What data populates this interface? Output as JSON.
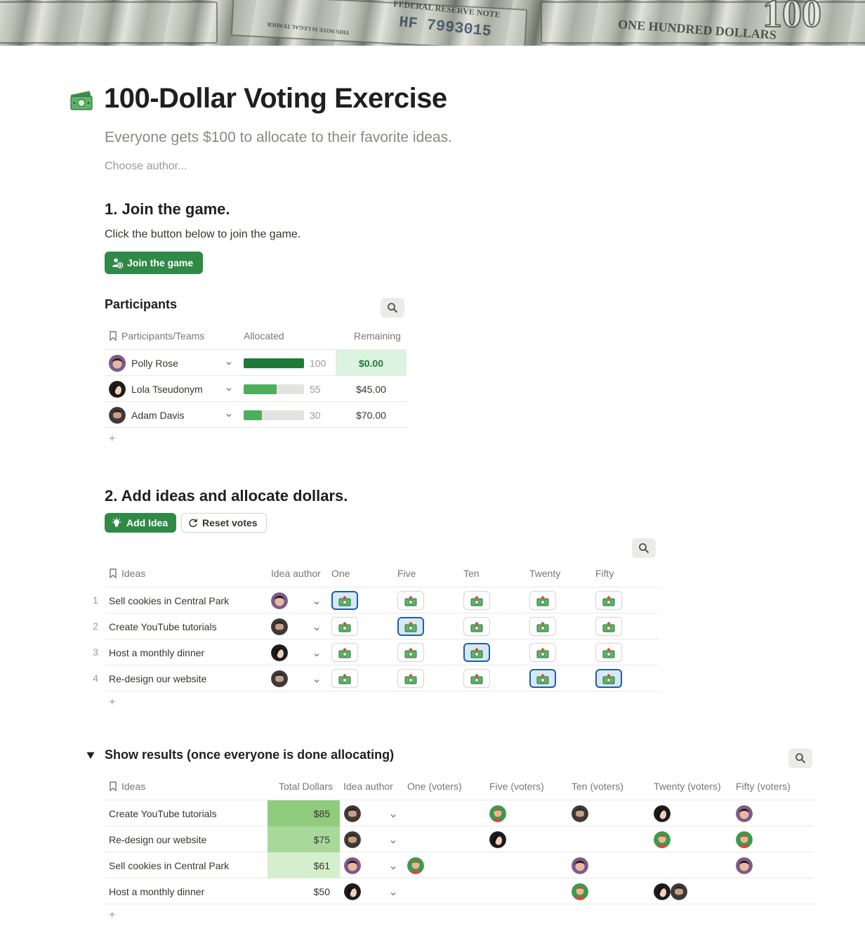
{
  "page": {
    "title": "100-Dollar Voting Exercise",
    "subtitle": "Everyone gets $100 to allocate to their favorite ideas.",
    "author_placeholder": "Choose author...",
    "icon": "money-bill-icon"
  },
  "cover": {
    "texts": [
      "FEDERAL RESERVE NOTE",
      "HF 7993015",
      "ONE HUNDRED DOLLARS",
      "THIS NOTE IS LEGAL TENDER",
      "100"
    ]
  },
  "section1": {
    "heading": "1. Join the game.",
    "instruction": "Click the button below to join the game.",
    "join_button": "Join the game"
  },
  "participants": {
    "heading": "Participants",
    "columns": [
      "Participants/Teams",
      "Allocated",
      "Remaining"
    ],
    "rows": [
      {
        "name": "Polly Rose",
        "allocated": 100,
        "allocated_label": "100",
        "remaining": "$0.00",
        "highlight": true
      },
      {
        "name": "Lola Tseudonym",
        "allocated": 55,
        "allocated_label": "55",
        "remaining": "$45.00",
        "highlight": false
      },
      {
        "name": "Adam Davis",
        "allocated": 30,
        "allocated_label": "30",
        "remaining": "$70.00",
        "highlight": false
      }
    ],
    "add_label": "+"
  },
  "section2": {
    "heading": "2. Add ideas and allocate dollars.",
    "add_idea_button": "Add Idea",
    "reset_button": "Reset votes"
  },
  "ideas": {
    "columns": [
      "Ideas",
      "Idea author",
      "One",
      "Five",
      "Ten",
      "Twenty",
      "Fifty"
    ],
    "rows": [
      {
        "num": "1",
        "idea": "Sell cookies in Central Park",
        "selected": [
          true,
          false,
          false,
          false,
          false
        ]
      },
      {
        "num": "2",
        "idea": "Create YouTube tutorials",
        "selected": [
          false,
          true,
          false,
          false,
          false
        ]
      },
      {
        "num": "3",
        "idea": "Host a monthly dinner",
        "selected": [
          false,
          false,
          true,
          false,
          false
        ]
      },
      {
        "num": "4",
        "idea": "Re-design our website",
        "selected": [
          false,
          false,
          false,
          true,
          true
        ]
      }
    ],
    "add_label": "+"
  },
  "results": {
    "heading": "Show results (once everyone is done allocating)",
    "columns": [
      "Ideas",
      "Total Dollars",
      "Idea author",
      "One (voters)",
      "Five (voters)",
      "Ten (voters)",
      "Twenty (voters)",
      "Fifty (voters)"
    ],
    "rows": [
      {
        "idea": "Create YouTube tutorials",
        "total": "$85",
        "total_value": 85
      },
      {
        "idea": "Re-design our website",
        "total": "$75",
        "total_value": 75
      },
      {
        "idea": "Sell cookies in Central Park",
        "total": "$61",
        "total_value": 61
      },
      {
        "idea": "Host a monthly dinner",
        "total": "$50",
        "total_value": 50
      }
    ],
    "add_label": "+"
  },
  "colors": {
    "accent_green": "#2f8a46",
    "bar_full": "#1e7a38",
    "bar_partial": "#4caf5c",
    "remaining_highlight": "#dcf3df",
    "selected_vote_border": "#1f5fa8",
    "selected_vote_bg": "#d7e8f5"
  }
}
